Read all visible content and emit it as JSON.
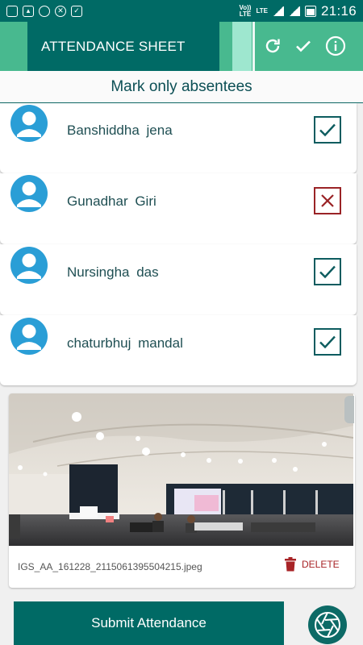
{
  "status_bar": {
    "left_icons": [
      "sim-icon",
      "image-icon",
      "whatsapp-icon",
      "app-icon",
      "bag-icon"
    ],
    "volte": "Vo))",
    "lte_small": "LTE",
    "lte": "LTE",
    "time": "21:16"
  },
  "app_bar": {
    "title": "ATTENDANCE SHEET",
    "actions": [
      "refresh-icon",
      "check-icon",
      "info-icon"
    ]
  },
  "subheader": {
    "text": "Mark only absentees"
  },
  "students": [
    {
      "name": "Banshiddha  jena",
      "absent": false
    },
    {
      "name": "Gunadhar  Giri",
      "absent": true
    },
    {
      "name": "Nursingha  das",
      "absent": false
    },
    {
      "name": "chaturbhuj  mandal",
      "absent": false
    }
  ],
  "attachment": {
    "filename": "IGS_AA_161228_2115061395504215.jpeg",
    "delete_label": "DELETE"
  },
  "submit_label": "Submit Attendance",
  "colors": {
    "primary_dark": "#006a65",
    "accent_green": "#48b98f",
    "light_green": "#9ee7cf",
    "avatar_blue": "#2a9ed6",
    "absent_red": "#9a2326"
  }
}
